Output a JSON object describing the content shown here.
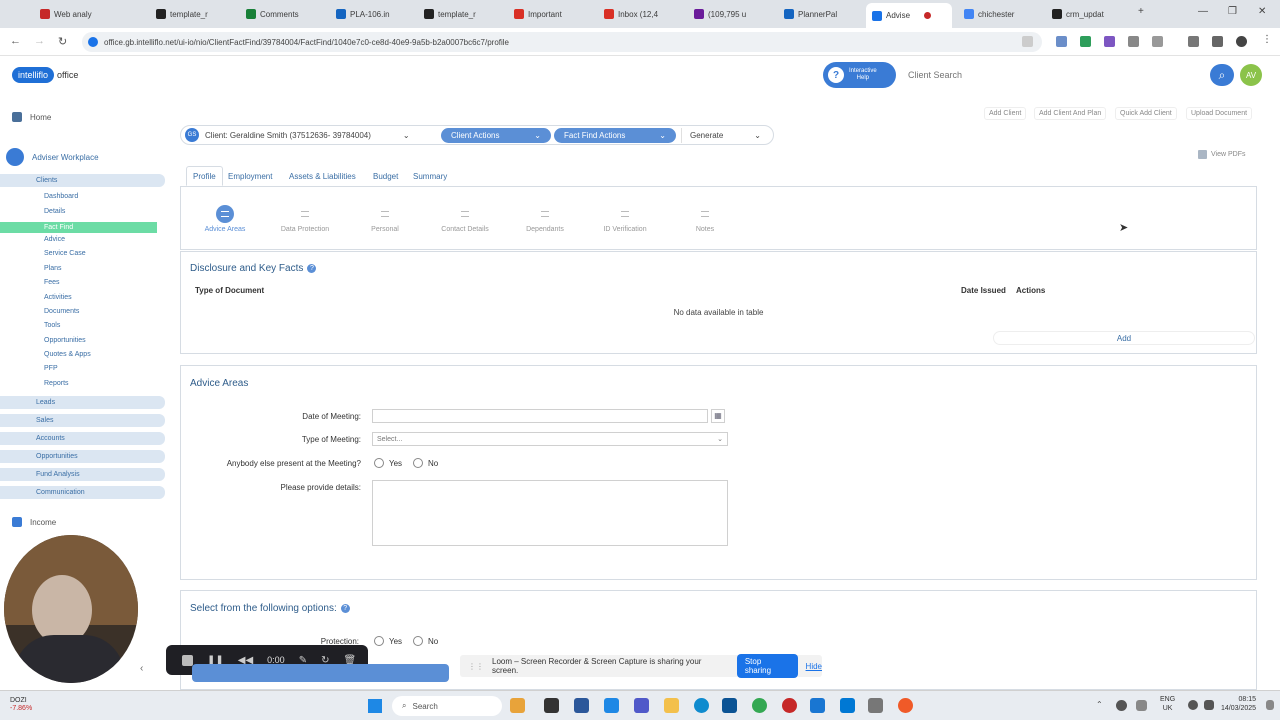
{
  "browser": {
    "tabs": [
      {
        "label": "Web analy",
        "color": "#c62828"
      },
      {
        "label": "template_r",
        "color": "#222222"
      },
      {
        "label": "Comments",
        "color": "#188038"
      },
      {
        "label": "PLA-106.in",
        "color": "#1565c0"
      },
      {
        "label": "template_r",
        "color": "#222222"
      },
      {
        "label": "Important",
        "color": "#d93025"
      },
      {
        "label": "Inbox (12,4",
        "color": "#d93025"
      },
      {
        "label": "(109,795 u",
        "color": "#6a1b9a"
      },
      {
        "label": "PlannerPal",
        "color": "#1565c0"
      },
      {
        "label": "Advise",
        "color": "#1a73e8"
      },
      {
        "label": "chichester",
        "color": "#4285f4"
      },
      {
        "label": "crm_updat",
        "color": "#222222"
      }
    ],
    "new_tab": "+",
    "minimize": "—",
    "maximize": "❐",
    "close": "✕",
    "back": "←",
    "forward": "→",
    "reload": "↻",
    "url": "office.gb.intelliflo.net/ui-io/nio/ClientFactFind/39784004/FactFind/1040e7c0-ce8d-40e9-9a5b-b2a0007bc6c7/profile"
  },
  "header": {
    "logo_pill": "intelliflo",
    "logo_text": "office",
    "help_line1": "Interactive",
    "help_line2": "Help",
    "help_q": "?",
    "search_placeholder": "Client Search",
    "search_icon": "⌕",
    "avatar": "AV"
  },
  "top_actions": [
    "Add Client",
    "Add Client And Plan",
    "Quick Add Client",
    "Upload Document"
  ],
  "view_pdfs": "View PDFs",
  "sidebar": {
    "home": "Home",
    "workplace": "Adviser Workplace",
    "clients": "Clients",
    "client_items": [
      "Dashboard",
      "Details",
      "Fact Find",
      "Advice",
      "Service Case",
      "Plans",
      "Fees",
      "Activities",
      "Documents",
      "Tools",
      "Opportunities",
      "Quotes & Apps",
      "PFP",
      "Reports"
    ],
    "sections": [
      "Leads",
      "Sales",
      "Accounts",
      "Opportunities",
      "Fund Analysis",
      "Communication"
    ],
    "income": "Income"
  },
  "client_bar": {
    "initials": "GS",
    "client": "Client: Geraldine Smith (37512636- 39784004)",
    "client_actions": "Client Actions",
    "fact_find_actions": "Fact Find Actions",
    "generate": "Generate",
    "caret": "⌄"
  },
  "tabs": [
    "Profile",
    "Employment",
    "Assets & Liabilities",
    "Budget",
    "Summary"
  ],
  "steps": [
    "Advice Areas",
    "Data Protection",
    "Personal",
    "Contact Details",
    "Dependants",
    "ID Verification",
    "Notes"
  ],
  "disclosure": {
    "title": "Disclosure and Key Facts",
    "col_type": "Type of Document",
    "col_date": "Date Issued",
    "col_actions": "Actions",
    "empty": "No data available in table",
    "add": "Add"
  },
  "advice_areas": {
    "title": "Advice Areas",
    "date_label": "Date of Meeting:",
    "type_label": "Type of Meeting:",
    "type_value": "Select...",
    "present_label": "Anybody else present at the Meeting?",
    "yes": "Yes",
    "no": "No",
    "details_label": "Please provide details:"
  },
  "options": {
    "title": "Select from the following options:",
    "protection_label": "Protection:",
    "yes": "Yes",
    "no": "No"
  },
  "info_mark": "?",
  "loom": {
    "time": "0:00",
    "share_text": "Loom – Screen Recorder & Screen Capture is sharing your screen.",
    "stop_sharing": "Stop sharing",
    "hide": "Hide"
  },
  "taskbar": {
    "stock_name": "DOZI",
    "stock_change": "-7.86%",
    "search": "Search",
    "lang1": "ENG",
    "lang2": "UK",
    "time": "08:15",
    "date": "14/03/2025"
  }
}
